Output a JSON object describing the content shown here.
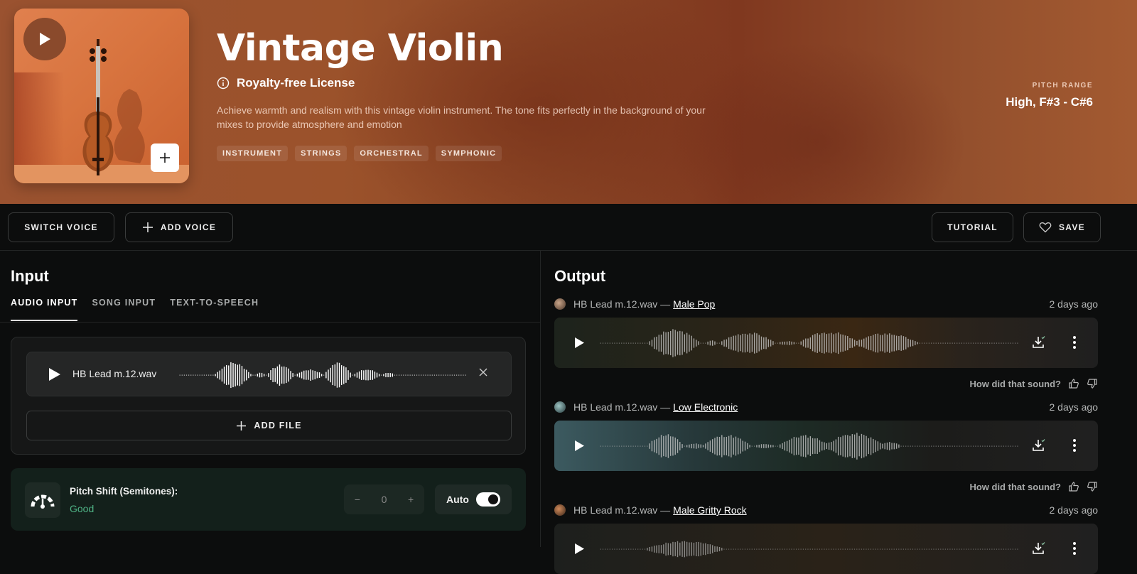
{
  "hero": {
    "title": "Vintage Violin",
    "license": "Royalty-free License",
    "description": "Achieve warmth and realism with this vintage violin instrument. The tone fits perfectly in the background of your mixes to provide atmosphere and emotion",
    "tags": [
      "INSTRUMENT",
      "STRINGS",
      "ORCHESTRAL",
      "SYMPHONIC"
    ],
    "pitch_range_label": "PITCH RANGE",
    "pitch_range_value": "High, F#3 - C#6",
    "icons": {
      "play": "play-icon",
      "add": "plus-icon",
      "info": "info-icon"
    }
  },
  "toolbar": {
    "switch_voice": "SWITCH VOICE",
    "add_voice": "ADD VOICE",
    "tutorial": "TUTORIAL",
    "save": "SAVE",
    "icons": {
      "add_voice": "plus-icon",
      "save": "heart-icon"
    }
  },
  "input": {
    "title": "Input",
    "tabs": [
      {
        "label": "AUDIO INPUT",
        "active": true
      },
      {
        "label": "SONG INPUT",
        "active": false
      },
      {
        "label": "TEXT-TO-SPEECH",
        "active": false
      }
    ],
    "file": {
      "name": "HB Lead m.12.wav"
    },
    "add_file": "ADD FILE",
    "pitch_shift": {
      "label": "Pitch Shift (Semitones):",
      "status": "Good",
      "status_color": "#4fb386",
      "value": "0",
      "minus": "−",
      "plus": "+",
      "auto_label": "Auto",
      "auto_enabled": true
    }
  },
  "output": {
    "title": "Output",
    "feedback_prompt": "How did that sound?",
    "items": [
      {
        "file": "HB Lead m.12.wav —",
        "voice": "Male Pop",
        "time": "2 days ago",
        "theme": "warm"
      },
      {
        "file": "HB Lead m.12.wav —",
        "voice": "Low Electronic",
        "time": "2 days ago",
        "theme": "teal"
      },
      {
        "file": "HB Lead m.12.wav —",
        "voice": "Male Gritty Rock",
        "time": "2 days ago",
        "theme": "rock"
      }
    ]
  }
}
